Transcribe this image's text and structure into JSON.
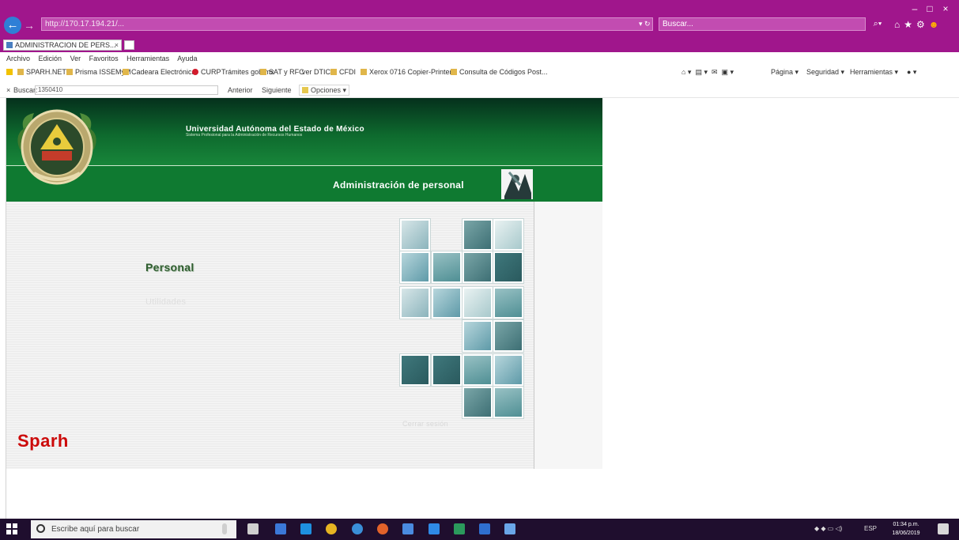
{
  "browser": {
    "address_url": "http://170.17.194.21/...",
    "address_host": "170.17.194.21",
    "search_placeholder": "Buscar...",
    "tab_title": "ADMINISTRACION DE PERS...",
    "window_controls": [
      "–",
      "□",
      "×"
    ]
  },
  "menu": [
    "Archivo",
    "Edición",
    "Ver",
    "Favoritos",
    "Herramientas",
    "Ayuda"
  ],
  "favorites": [
    "SPARH.NET",
    "Prisma ISSEMyM",
    "Cadeara Electrónica",
    "CURP",
    "Trámites gob.mx",
    "SAT y RFC",
    "ver DTIC",
    "CFDI",
    "Xerox 0716 Copier-Printer",
    "Consulta de Códigos Post..."
  ],
  "command_bar": [
    "Página",
    "Seguridad",
    "Herramientas"
  ],
  "find": {
    "close": "×",
    "label": "Buscar:",
    "value": "1350410",
    "prev": "Anterior",
    "next": "Siguiente",
    "options": "Opciones"
  },
  "page": {
    "header_title": "Universidad Autónoma del Estado de México",
    "header_subtitle": "Sistema Profesional para la Administración de Recursos Humanos",
    "section_title": "Administración de personal",
    "nav": {
      "personal": "Personal",
      "utilidades": "Utilidades",
      "cerrar": "Cerrar sesión"
    },
    "brand": "Sparh"
  },
  "taskbar": {
    "search_placeholder": "Escribe aquí para buscar",
    "tray_lang": "ESP",
    "time": "01:34 p.m.",
    "date": "18/06/2019"
  },
  "colors": {
    "browser_chrome": "#a0168c",
    "header_green": "#0f7a31",
    "brand_red": "#cc0a0a",
    "nav_green": "#2f5e2f"
  }
}
